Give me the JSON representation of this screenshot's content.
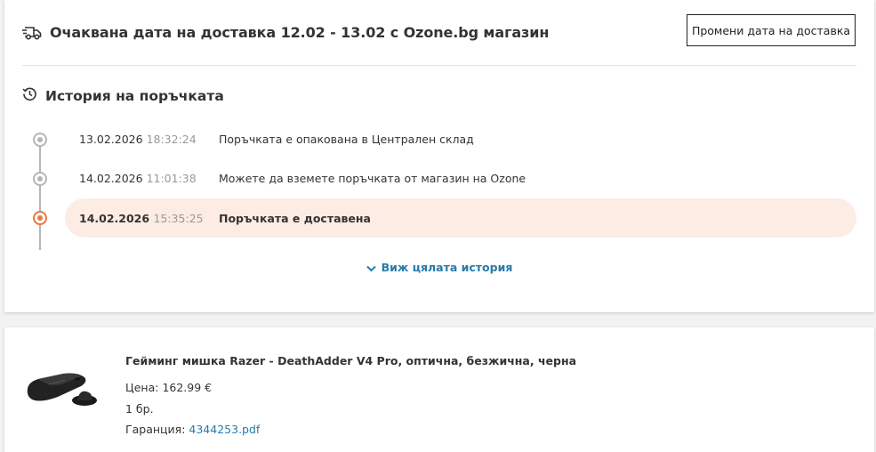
{
  "delivery": {
    "title": "Очаквана дата на доставка 12.02 - 13.02 с Ozone.bg магазин",
    "change_button_label": "Промени дата на доставка"
  },
  "history": {
    "title": "История на поръчката",
    "events": [
      {
        "date": "13.02.2026",
        "time": "18:32:24",
        "description": "Поръчката е опакована в Централен склад",
        "status": "past"
      },
      {
        "date": "14.02.2026",
        "time": "11:01:38",
        "description": "Можете да вземете поръчката от магазин на Ozone",
        "status": "past"
      },
      {
        "date": "14.02.2026",
        "time": "15:35:25",
        "description": "Поръчката е доставена",
        "status": "current"
      }
    ],
    "view_all_label": "Виж цялата история"
  },
  "product": {
    "name": "Гейминг мишка Razer - DeathAdder V4 Pro, оптична, безжична, черна",
    "price_label": "Цена:",
    "price_value": "162.99 €",
    "quantity": "1 бр.",
    "warranty_label": "Гаранция:",
    "warranty_file": "4344253.pdf"
  },
  "colors": {
    "accent_orange": "#ec7640",
    "highlight_bg": "#fdece4",
    "link_blue": "#2a7aa8",
    "timeline_grey": "#b5b5b5"
  },
  "icons": [
    "delivery-truck-icon",
    "history-clock-icon",
    "chevron-down-icon",
    "product-image"
  ]
}
